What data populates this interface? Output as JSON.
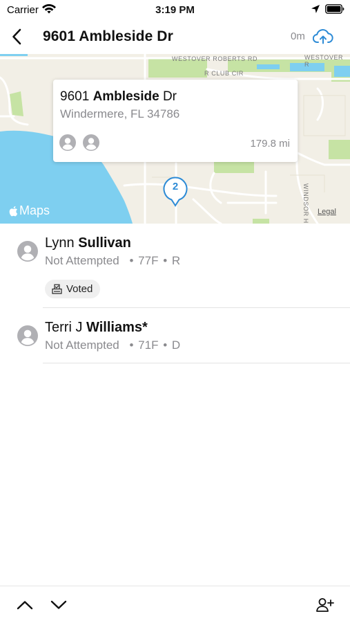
{
  "status_bar": {
    "carrier": "Carrier",
    "time": "3:19 PM",
    "icons": [
      "wifi-icon",
      "location-arrow-icon",
      "battery-icon"
    ]
  },
  "nav": {
    "title": "9601 Ambleside Dr",
    "elapsed": "0m",
    "back_icon": "chevron-left-icon",
    "upload_icon": "cloud-upload-icon"
  },
  "map": {
    "road_labels": [
      "WESTOVER ROBERTS RD",
      "WESTOVER R",
      "R CLUB CIR",
      "WINDSOR H"
    ],
    "brand": "Maps",
    "legal": "Legal",
    "callout": {
      "street_number": "9601",
      "street_name": "Ambleside",
      "street_suffix": "Dr",
      "city": "Windermere, FL 34786",
      "distance": "179.8 mi",
      "avatar_icon": "person-circle-icon"
    },
    "pin_count": "2",
    "colors": {
      "water": "#7ecff0",
      "park": "#c6e3a4",
      "land": "#f2efe6",
      "accent": "#2d8bd6"
    }
  },
  "people": [
    {
      "first": "Lynn",
      "last": "Sullivan",
      "status": "Not Attempted",
      "age": "77F",
      "party": "R",
      "tag": "Voted"
    },
    {
      "first": "Terri J",
      "last": "Williams*",
      "status": "Not Attempted",
      "age": "71F",
      "party": "D"
    }
  ],
  "meta_separator": "•",
  "toolbar": {
    "icons": [
      "chevron-up-icon",
      "chevron-down-icon",
      "add-person-icon"
    ]
  }
}
